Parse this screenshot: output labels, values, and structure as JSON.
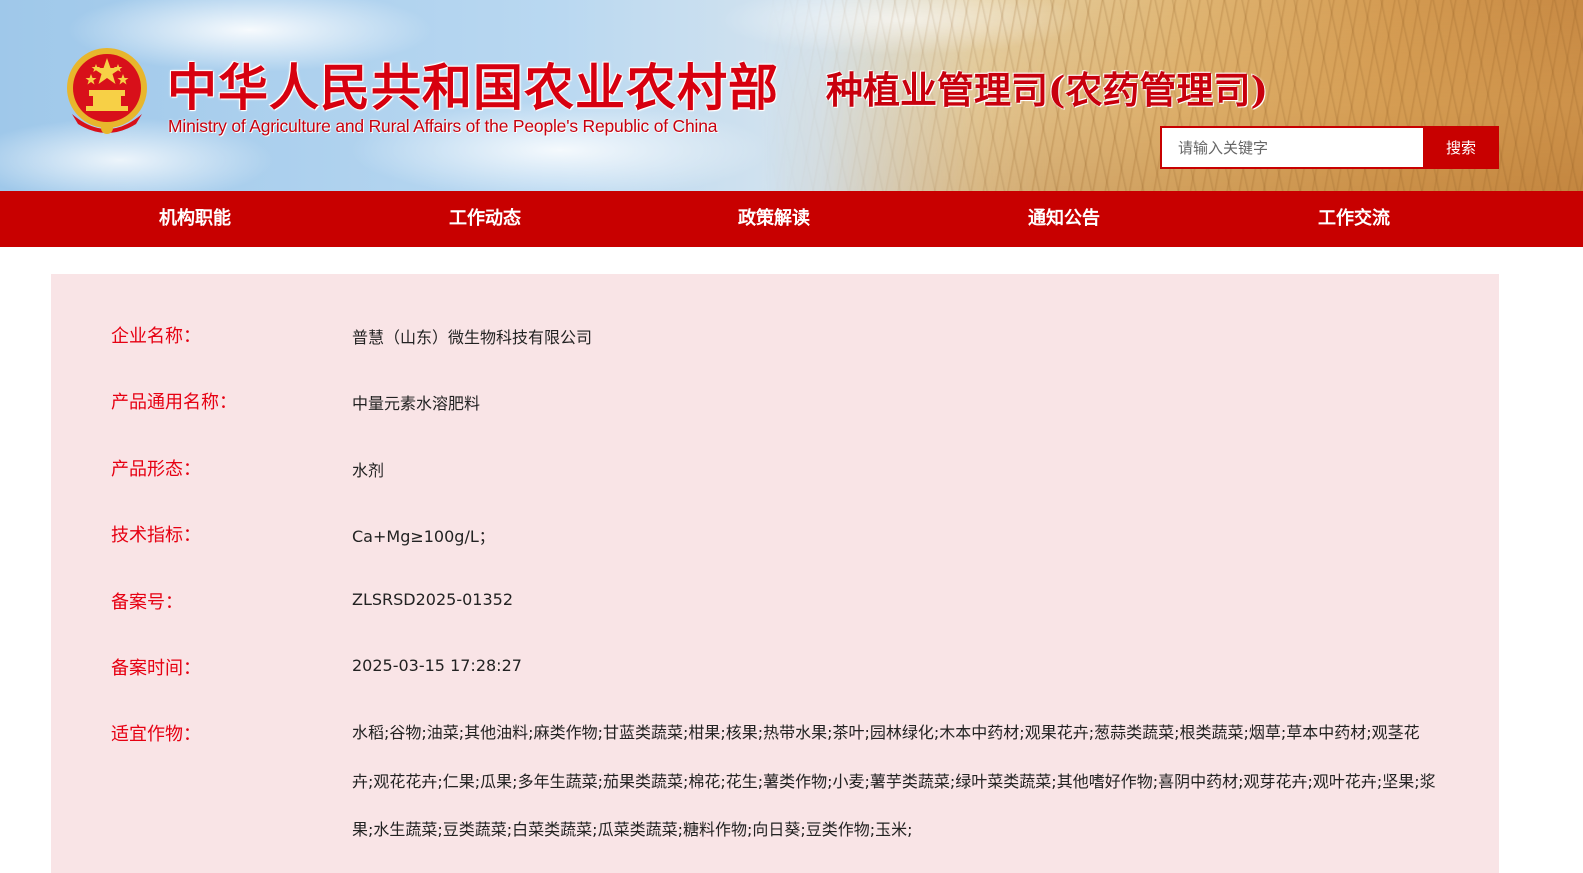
{
  "header": {
    "logo_cn": "中华人民共和国农业农村部",
    "logo_en": "Ministry of Agriculture and Rural Affairs of the People's Republic of China",
    "department": "种植业管理司(农药管理司)",
    "search": {
      "placeholder": "请输入关键字",
      "button_label": "搜索"
    }
  },
  "nav": {
    "items": [
      {
        "label": "机构职能"
      },
      {
        "label": "工作动态"
      },
      {
        "label": "政策解读"
      },
      {
        "label": "通知公告"
      },
      {
        "label": "工作交流"
      }
    ]
  },
  "details": {
    "rows": [
      {
        "label": "企业名称：",
        "value": "普慧（山东）微生物科技有限公司"
      },
      {
        "label": "产品通用名称：",
        "value": "中量元素水溶肥料"
      },
      {
        "label": "产品形态：",
        "value": "水剂"
      },
      {
        "label": "技术指标：",
        "value": "Ca+Mg≥100g/L；"
      },
      {
        "label": "备案号：",
        "value": "ZLSRSD2025-01352"
      },
      {
        "label": "备案时间：",
        "value": "2025-03-15 17:28:27"
      },
      {
        "label": "适宜作物：",
        "value": "水稻;谷物;油菜;其他油料;麻类作物;甘蓝类蔬菜;柑果;核果;热带水果;茶叶;园林绿化;木本中药材;观果花卉;葱蒜类蔬菜;根类蔬菜;烟草;草本中药材;观茎花卉;观花花卉;仁果;瓜果;多年生蔬菜;茄果类蔬菜;棉花;花生;薯类作物;小麦;薯芋类蔬菜;绿叶菜类蔬菜;其他嗜好作物;喜阴中药材;观芽花卉;观叶花卉;坚果;浆果;水生蔬菜;豆类蔬菜;白菜类蔬菜;瓜菜类蔬菜;糖料作物;向日葵;豆类作物;玉米;"
      }
    ]
  },
  "colors": {
    "brand_red": "#c80000",
    "label_red": "#e60012",
    "panel_bg": "#f9e4e6"
  },
  "icons": {
    "emblem": "national-emblem-icon"
  }
}
